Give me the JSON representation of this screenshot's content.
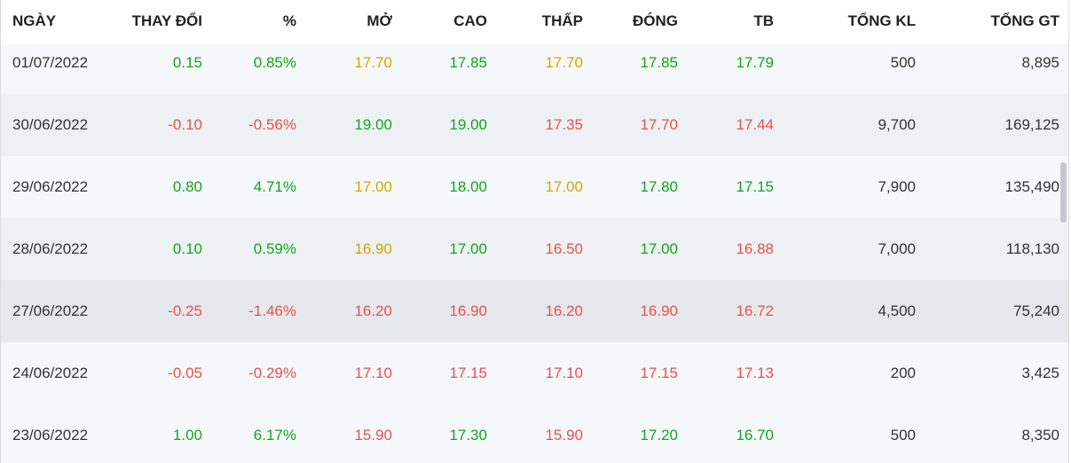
{
  "headers": {
    "date": "NGÀY",
    "change": "THAY ĐỔI",
    "percent": "%",
    "open": "MỞ",
    "high": "CAO",
    "low": "THẤP",
    "close": "ĐÓNG",
    "avg": "TB",
    "total_volume": "TỔNG KL",
    "total_value": "TỔNG GT"
  },
  "colors": {
    "up": "#13a61a",
    "down": "#e8524a",
    "reference": "#d6a400"
  },
  "rows": [
    {
      "date": "01/07/2022",
      "change": "0.15",
      "percent": "0.85%",
      "open": "17.70",
      "high": "17.85",
      "low": "17.70",
      "close": "17.85",
      "avg": "17.79",
      "volume": "500",
      "value": "8,895"
    },
    {
      "date": "30/06/2022",
      "change": "-0.10",
      "percent": "-0.56%",
      "open": "19.00",
      "high": "19.00",
      "low": "17.35",
      "close": "17.70",
      "avg": "17.44",
      "volume": "9,700",
      "value": "169,125"
    },
    {
      "date": "29/06/2022",
      "change": "0.80",
      "percent": "4.71%",
      "open": "17.00",
      "high": "18.00",
      "low": "17.00",
      "close": "17.80",
      "avg": "17.15",
      "volume": "7,900",
      "value": "135,490"
    },
    {
      "date": "28/06/2022",
      "change": "0.10",
      "percent": "0.59%",
      "open": "16.90",
      "high": "17.00",
      "low": "16.50",
      "close": "17.00",
      "avg": "16.88",
      "volume": "7,000",
      "value": "118,130"
    },
    {
      "date": "27/06/2022",
      "change": "-0.25",
      "percent": "-1.46%",
      "open": "16.20",
      "high": "16.90",
      "low": "16.20",
      "close": "16.90",
      "avg": "16.72",
      "volume": "4,500",
      "value": "75,240"
    },
    {
      "date": "24/06/2022",
      "change": "-0.05",
      "percent": "-0.29%",
      "open": "17.10",
      "high": "17.15",
      "low": "17.10",
      "close": "17.15",
      "avg": "17.13",
      "volume": "200",
      "value": "3,425"
    },
    {
      "date": "23/06/2022",
      "change": "1.00",
      "percent": "6.17%",
      "open": "15.90",
      "high": "17.30",
      "low": "15.90",
      "close": "17.20",
      "avg": "16.70",
      "volume": "500",
      "value": "8,350"
    }
  ]
}
